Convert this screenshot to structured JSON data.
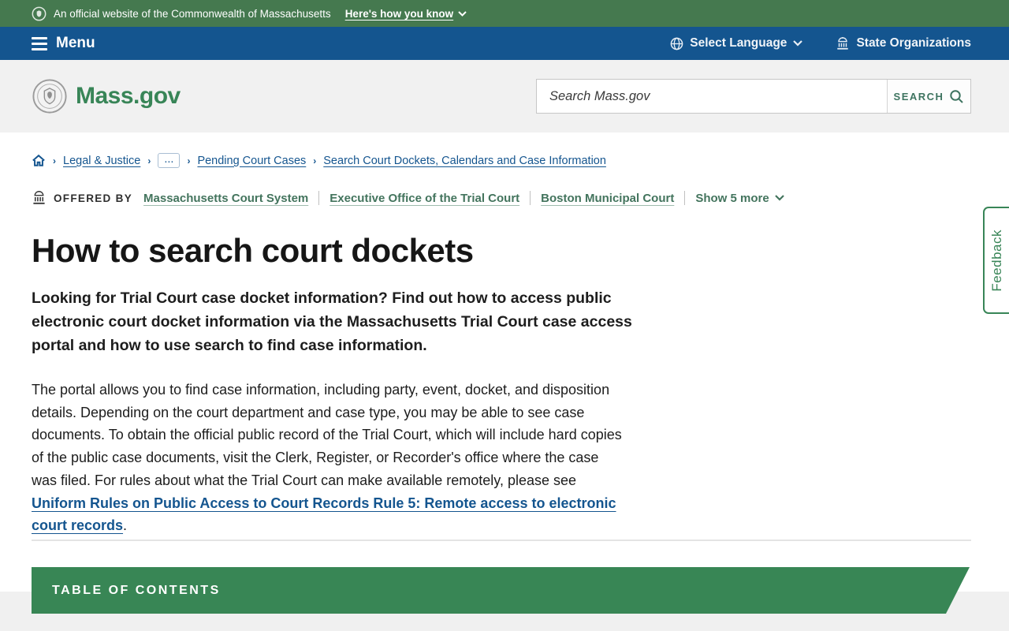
{
  "banner": {
    "text": "An official website of the Commonwealth of Massachusetts",
    "how_label": "Here's how you know"
  },
  "navbar": {
    "menu_label": "Menu",
    "language_label": "Select Language",
    "state_orgs_label": "State Organizations"
  },
  "header": {
    "logo_text": "Mass.gov",
    "search_placeholder": "Search Mass.gov",
    "search_button": "SEARCH"
  },
  "breadcrumb": {
    "items": [
      {
        "label": "Legal & Justice"
      },
      {
        "label": "..."
      },
      {
        "label": "Pending Court Cases"
      },
      {
        "label": "Search Court Dockets, Calendars and Case Information"
      }
    ]
  },
  "offered_by": {
    "label": "OFFERED BY",
    "orgs": [
      "Massachusetts Court System",
      "Executive Office of the Trial Court",
      "Boston Municipal Court"
    ],
    "show_more": "Show 5 more"
  },
  "article": {
    "title": "How to search court dockets",
    "intro": "Looking for Trial Court case docket information? Find out how to access public electronic court docket information via the Massachusetts Trial Court case access portal and how to use search to find case information.",
    "body_before_link": "The portal allows you to find case information, including party, event, docket, and disposition details. Depending on the court department and case type, you may be able to see case documents. To obtain the official public record of the Trial Court, which will include hard copies of the public case documents, visit the Clerk, Register, or Recorder's office where the case was filed. For rules about what the Trial Court can make available remotely, please see ",
    "body_link": "Uniform Rules on Public Access to Court Records Rule 5: Remote access to electronic court records",
    "body_after_link": "."
  },
  "toc": {
    "label": "TABLE OF CONTENTS"
  },
  "feedback": {
    "label": "Feedback"
  },
  "colors": {
    "banner_green": "#45794f",
    "nav_blue": "#14558f",
    "brand_green": "#388557",
    "link_blue": "#14558f",
    "offered_link_green": "#43745d",
    "header_gray": "#f1f1f1",
    "toc_green": "#388655"
  }
}
